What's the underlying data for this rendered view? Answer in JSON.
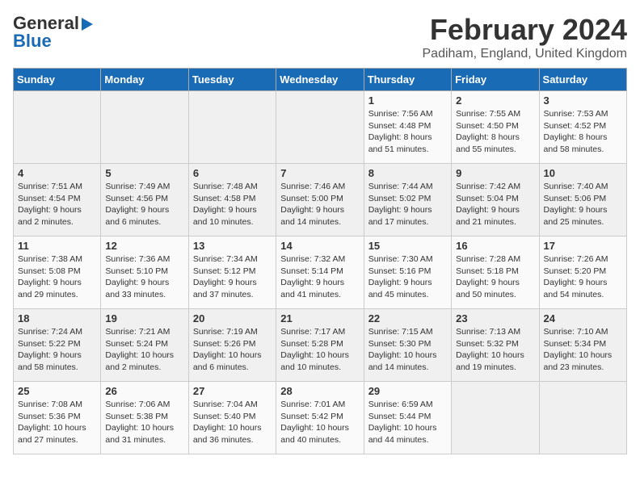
{
  "header": {
    "logo_general": "General",
    "logo_blue": "Blue",
    "month": "February 2024",
    "location": "Padiham, England, United Kingdom"
  },
  "days_of_week": [
    "Sunday",
    "Monday",
    "Tuesday",
    "Wednesday",
    "Thursday",
    "Friday",
    "Saturday"
  ],
  "weeks": [
    [
      {
        "day": "",
        "empty": true
      },
      {
        "day": "",
        "empty": true
      },
      {
        "day": "",
        "empty": true
      },
      {
        "day": "",
        "empty": true
      },
      {
        "day": "1",
        "sunrise": "7:56 AM",
        "sunset": "4:48 PM",
        "daylight": "8 hours and 51 minutes."
      },
      {
        "day": "2",
        "sunrise": "7:55 AM",
        "sunset": "4:50 PM",
        "daylight": "8 hours and 55 minutes."
      },
      {
        "day": "3",
        "sunrise": "7:53 AM",
        "sunset": "4:52 PM",
        "daylight": "8 hours and 58 minutes."
      }
    ],
    [
      {
        "day": "4",
        "sunrise": "7:51 AM",
        "sunset": "4:54 PM",
        "daylight": "9 hours and 2 minutes."
      },
      {
        "day": "5",
        "sunrise": "7:49 AM",
        "sunset": "4:56 PM",
        "daylight": "9 hours and 6 minutes."
      },
      {
        "day": "6",
        "sunrise": "7:48 AM",
        "sunset": "4:58 PM",
        "daylight": "9 hours and 10 minutes."
      },
      {
        "day": "7",
        "sunrise": "7:46 AM",
        "sunset": "5:00 PM",
        "daylight": "9 hours and 14 minutes."
      },
      {
        "day": "8",
        "sunrise": "7:44 AM",
        "sunset": "5:02 PM",
        "daylight": "9 hours and 17 minutes."
      },
      {
        "day": "9",
        "sunrise": "7:42 AM",
        "sunset": "5:04 PM",
        "daylight": "9 hours and 21 minutes."
      },
      {
        "day": "10",
        "sunrise": "7:40 AM",
        "sunset": "5:06 PM",
        "daylight": "9 hours and 25 minutes."
      }
    ],
    [
      {
        "day": "11",
        "sunrise": "7:38 AM",
        "sunset": "5:08 PM",
        "daylight": "9 hours and 29 minutes."
      },
      {
        "day": "12",
        "sunrise": "7:36 AM",
        "sunset": "5:10 PM",
        "daylight": "9 hours and 33 minutes."
      },
      {
        "day": "13",
        "sunrise": "7:34 AM",
        "sunset": "5:12 PM",
        "daylight": "9 hours and 37 minutes."
      },
      {
        "day": "14",
        "sunrise": "7:32 AM",
        "sunset": "5:14 PM",
        "daylight": "9 hours and 41 minutes."
      },
      {
        "day": "15",
        "sunrise": "7:30 AM",
        "sunset": "5:16 PM",
        "daylight": "9 hours and 45 minutes."
      },
      {
        "day": "16",
        "sunrise": "7:28 AM",
        "sunset": "5:18 PM",
        "daylight": "9 hours and 50 minutes."
      },
      {
        "day": "17",
        "sunrise": "7:26 AM",
        "sunset": "5:20 PM",
        "daylight": "9 hours and 54 minutes."
      }
    ],
    [
      {
        "day": "18",
        "sunrise": "7:24 AM",
        "sunset": "5:22 PM",
        "daylight": "9 hours and 58 minutes."
      },
      {
        "day": "19",
        "sunrise": "7:21 AM",
        "sunset": "5:24 PM",
        "daylight": "10 hours and 2 minutes."
      },
      {
        "day": "20",
        "sunrise": "7:19 AM",
        "sunset": "5:26 PM",
        "daylight": "10 hours and 6 minutes."
      },
      {
        "day": "21",
        "sunrise": "7:17 AM",
        "sunset": "5:28 PM",
        "daylight": "10 hours and 10 minutes."
      },
      {
        "day": "22",
        "sunrise": "7:15 AM",
        "sunset": "5:30 PM",
        "daylight": "10 hours and 14 minutes."
      },
      {
        "day": "23",
        "sunrise": "7:13 AM",
        "sunset": "5:32 PM",
        "daylight": "10 hours and 19 minutes."
      },
      {
        "day": "24",
        "sunrise": "7:10 AM",
        "sunset": "5:34 PM",
        "daylight": "10 hours and 23 minutes."
      }
    ],
    [
      {
        "day": "25",
        "sunrise": "7:08 AM",
        "sunset": "5:36 PM",
        "daylight": "10 hours and 27 minutes."
      },
      {
        "day": "26",
        "sunrise": "7:06 AM",
        "sunset": "5:38 PM",
        "daylight": "10 hours and 31 minutes."
      },
      {
        "day": "27",
        "sunrise": "7:04 AM",
        "sunset": "5:40 PM",
        "daylight": "10 hours and 36 minutes."
      },
      {
        "day": "28",
        "sunrise": "7:01 AM",
        "sunset": "5:42 PM",
        "daylight": "10 hours and 40 minutes."
      },
      {
        "day": "29",
        "sunrise": "6:59 AM",
        "sunset": "5:44 PM",
        "daylight": "10 hours and 44 minutes."
      },
      {
        "day": "",
        "empty": true
      },
      {
        "day": "",
        "empty": true
      }
    ]
  ]
}
